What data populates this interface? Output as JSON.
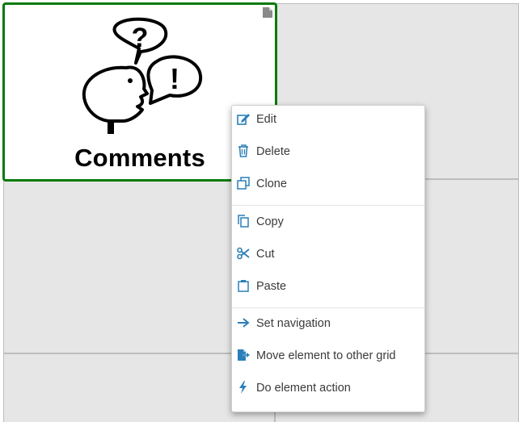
{
  "tile": {
    "label": "Comments",
    "border_color": "#0a7a0a",
    "image_icon": "speech-bubbles-question-exclamation-icon"
  },
  "context_menu": {
    "accent_color": "#2a7fb8",
    "items": [
      {
        "id": "edit",
        "label": "Edit",
        "icon": "edit-icon"
      },
      {
        "id": "delete",
        "label": "Delete",
        "icon": "trash-icon"
      },
      {
        "id": "clone",
        "label": "Clone",
        "icon": "clone-icon"
      },
      {
        "id": "copy",
        "label": "Copy",
        "icon": "copy-icon"
      },
      {
        "id": "cut",
        "label": "Cut",
        "icon": "scissors-icon"
      },
      {
        "id": "paste",
        "label": "Paste",
        "icon": "clipboard-icon"
      },
      {
        "id": "set-navigation",
        "label": "Set navigation",
        "icon": "arrow-right-icon"
      },
      {
        "id": "move-element",
        "label": "Move element to other grid",
        "icon": "file-export-icon"
      },
      {
        "id": "do-action",
        "label": "Do element action",
        "icon": "bolt-icon"
      }
    ]
  }
}
